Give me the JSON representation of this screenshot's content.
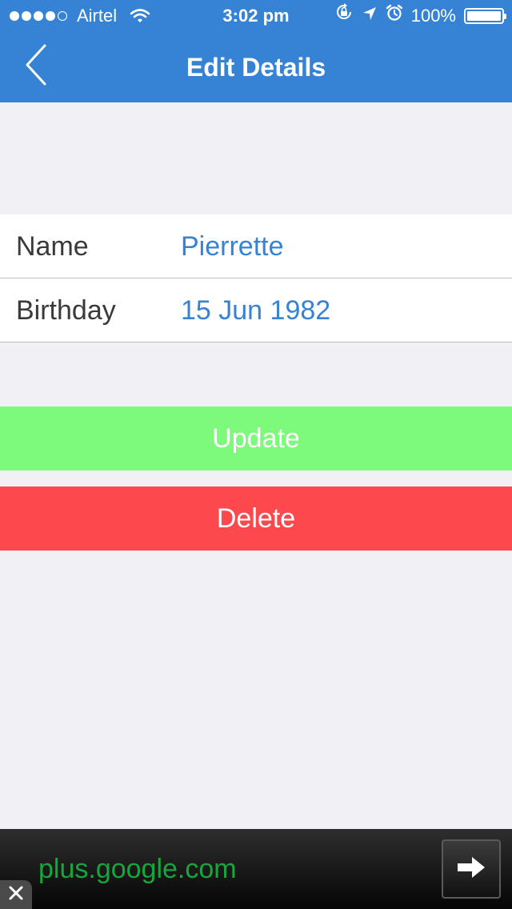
{
  "status_bar": {
    "carrier": "Airtel",
    "time": "3:02 pm",
    "battery": "100%",
    "battery_level": 1.0
  },
  "header": {
    "title": "Edit Details"
  },
  "form": {
    "rows": [
      {
        "label": "Name",
        "value": "Pierrette"
      },
      {
        "label": "Birthday",
        "value": "15 Jun 1982"
      }
    ]
  },
  "actions": {
    "update_label": "Update",
    "delete_label": "Delete"
  },
  "ad": {
    "text": "plus.google.com"
  },
  "colors": {
    "header": "#3683d6",
    "value": "#3683d6",
    "update": "#7dfa7b",
    "delete": "#fd484d",
    "ad_text": "#17a53d"
  },
  "icons": {
    "back": "chevron-left-icon",
    "ad_arrow": "arrow-right-icon",
    "ad_close": "close-icon"
  }
}
